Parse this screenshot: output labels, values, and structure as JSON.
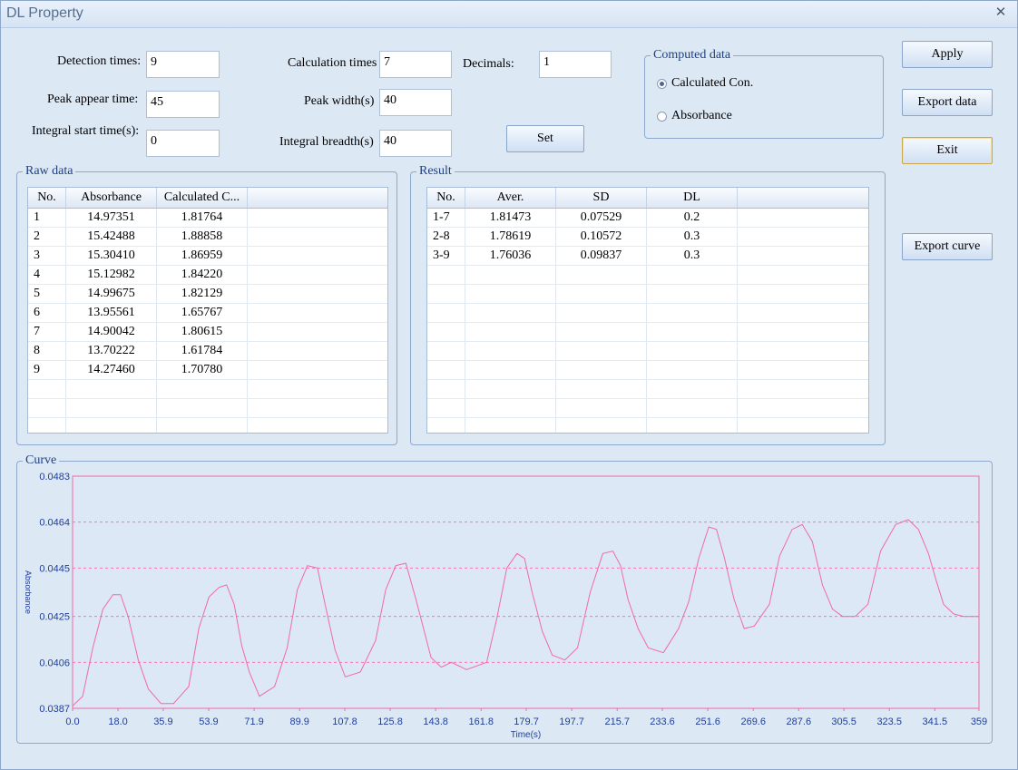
{
  "window": {
    "title": "DL Property"
  },
  "params": {
    "detection_times": {
      "label": "Detection times:",
      "value": "9"
    },
    "peak_appear_time": {
      "label": "Peak appear time:",
      "value": "45"
    },
    "integral_start_time": {
      "label": "Integral start time(s):",
      "value": "0"
    },
    "calculation_times": {
      "label": "Calculation times",
      "value": "7"
    },
    "peak_width": {
      "label": "Peak width(s)",
      "value": "40"
    },
    "integral_breadth": {
      "label": "Integral breadth(s)",
      "value": "40"
    },
    "decimals": {
      "label": "Decimals:",
      "value": "1"
    },
    "set_label": "Set"
  },
  "computed": {
    "title": "Computed data",
    "options": [
      "Calculated Con.",
      "Absorbance"
    ],
    "selected": 0
  },
  "buttons": {
    "apply": "Apply",
    "export_data": "Export data",
    "exit": "Exit",
    "export_curve": "Export curve"
  },
  "raw_data": {
    "title": "Raw data",
    "columns": [
      "No.",
      "Absorbance",
      "Calculated C..."
    ],
    "rows": [
      [
        "1",
        "14.97351",
        "1.81764"
      ],
      [
        "2",
        "15.42488",
        "1.88858"
      ],
      [
        "3",
        "15.30410",
        "1.86959"
      ],
      [
        "4",
        "15.12982",
        "1.84220"
      ],
      [
        "5",
        "14.99675",
        "1.82129"
      ],
      [
        "6",
        "13.95561",
        "1.65767"
      ],
      [
        "7",
        "14.90042",
        "1.80615"
      ],
      [
        "8",
        "13.70222",
        "1.61784"
      ],
      [
        "9",
        "14.27460",
        "1.70780"
      ]
    ]
  },
  "result": {
    "title": "Result",
    "columns": [
      "No.",
      "Aver.",
      "SD",
      "DL"
    ],
    "rows": [
      [
        "1-7",
        "1.81473",
        "0.07529",
        "0.2"
      ],
      [
        "2-8",
        "1.78619",
        "0.10572",
        "0.3"
      ],
      [
        "3-9",
        "1.76036",
        "0.09837",
        "0.3"
      ]
    ]
  },
  "curve": {
    "title": "Curve",
    "colors": {
      "line": "#f06aa8",
      "axis_text": "#1f3f9a",
      "grid": "#f06aa8",
      "plot_bg": "#dce8f5"
    },
    "chart_data": {
      "type": "line",
      "xlabel": "Time(s)",
      "ylabel": "Absorbance",
      "xlim": [
        0,
        359
      ],
      "ylim": [
        0.0387,
        0.0483
      ],
      "x_ticks": [
        "0.0",
        "18.0",
        "35.9",
        "53.9",
        "71.9",
        "89.9",
        "107.8",
        "125.8",
        "143.8",
        "161.8",
        "179.7",
        "197.7",
        "215.7",
        "233.6",
        "251.6",
        "269.6",
        "287.6",
        "305.5",
        "323.5",
        "341.5",
        "359"
      ],
      "y_ticks": [
        "0.0387",
        "0.0406",
        "0.0425",
        "0.0445",
        "0.0464",
        "0.0483"
      ],
      "grid": "horizontal dashed",
      "series": [
        {
          "x": [
            0,
            4,
            8,
            12,
            16,
            19,
            22,
            26,
            30,
            35,
            40,
            46,
            50,
            54,
            58,
            61,
            64,
            67,
            70,
            74,
            80,
            85,
            89,
            93,
            97,
            100,
            104,
            108,
            114,
            120,
            124,
            128,
            132,
            136,
            139,
            142,
            146,
            150,
            156,
            164,
            168,
            172,
            176,
            179,
            182,
            186,
            190,
            195,
            200,
            205,
            210,
            214,
            217,
            220,
            224,
            228,
            234,
            240,
            244,
            248,
            252,
            255,
            258,
            262,
            266,
            270,
            276,
            280,
            285,
            289,
            293,
            297,
            301,
            305,
            310,
            315,
            320,
            326,
            331,
            335,
            339,
            342,
            345,
            349,
            353,
            357,
            359
          ],
          "y": [
            0.0388,
            0.0392,
            0.0412,
            0.0428,
            0.0434,
            0.0434,
            0.0425,
            0.0407,
            0.0395,
            0.0389,
            0.0389,
            0.0396,
            0.042,
            0.0433,
            0.0437,
            0.0438,
            0.043,
            0.0413,
            0.0402,
            0.0392,
            0.0396,
            0.0412,
            0.0436,
            0.0446,
            0.0445,
            0.043,
            0.0411,
            0.04,
            0.0402,
            0.0415,
            0.0436,
            0.0446,
            0.0447,
            0.0432,
            0.042,
            0.0408,
            0.0404,
            0.0406,
            0.0403,
            0.0406,
            0.0424,
            0.0445,
            0.0451,
            0.0449,
            0.0435,
            0.0419,
            0.0409,
            0.0407,
            0.0412,
            0.0435,
            0.0451,
            0.0452,
            0.0446,
            0.0432,
            0.042,
            0.0412,
            0.041,
            0.042,
            0.0431,
            0.0449,
            0.0462,
            0.0461,
            0.045,
            0.0432,
            0.042,
            0.0421,
            0.043,
            0.045,
            0.0461,
            0.0463,
            0.0456,
            0.0438,
            0.0428,
            0.0425,
            0.0425,
            0.043,
            0.0452,
            0.0463,
            0.0465,
            0.0461,
            0.0451,
            0.044,
            0.043,
            0.0426,
            0.0425,
            0.0425,
            0.0425
          ]
        }
      ]
    }
  }
}
